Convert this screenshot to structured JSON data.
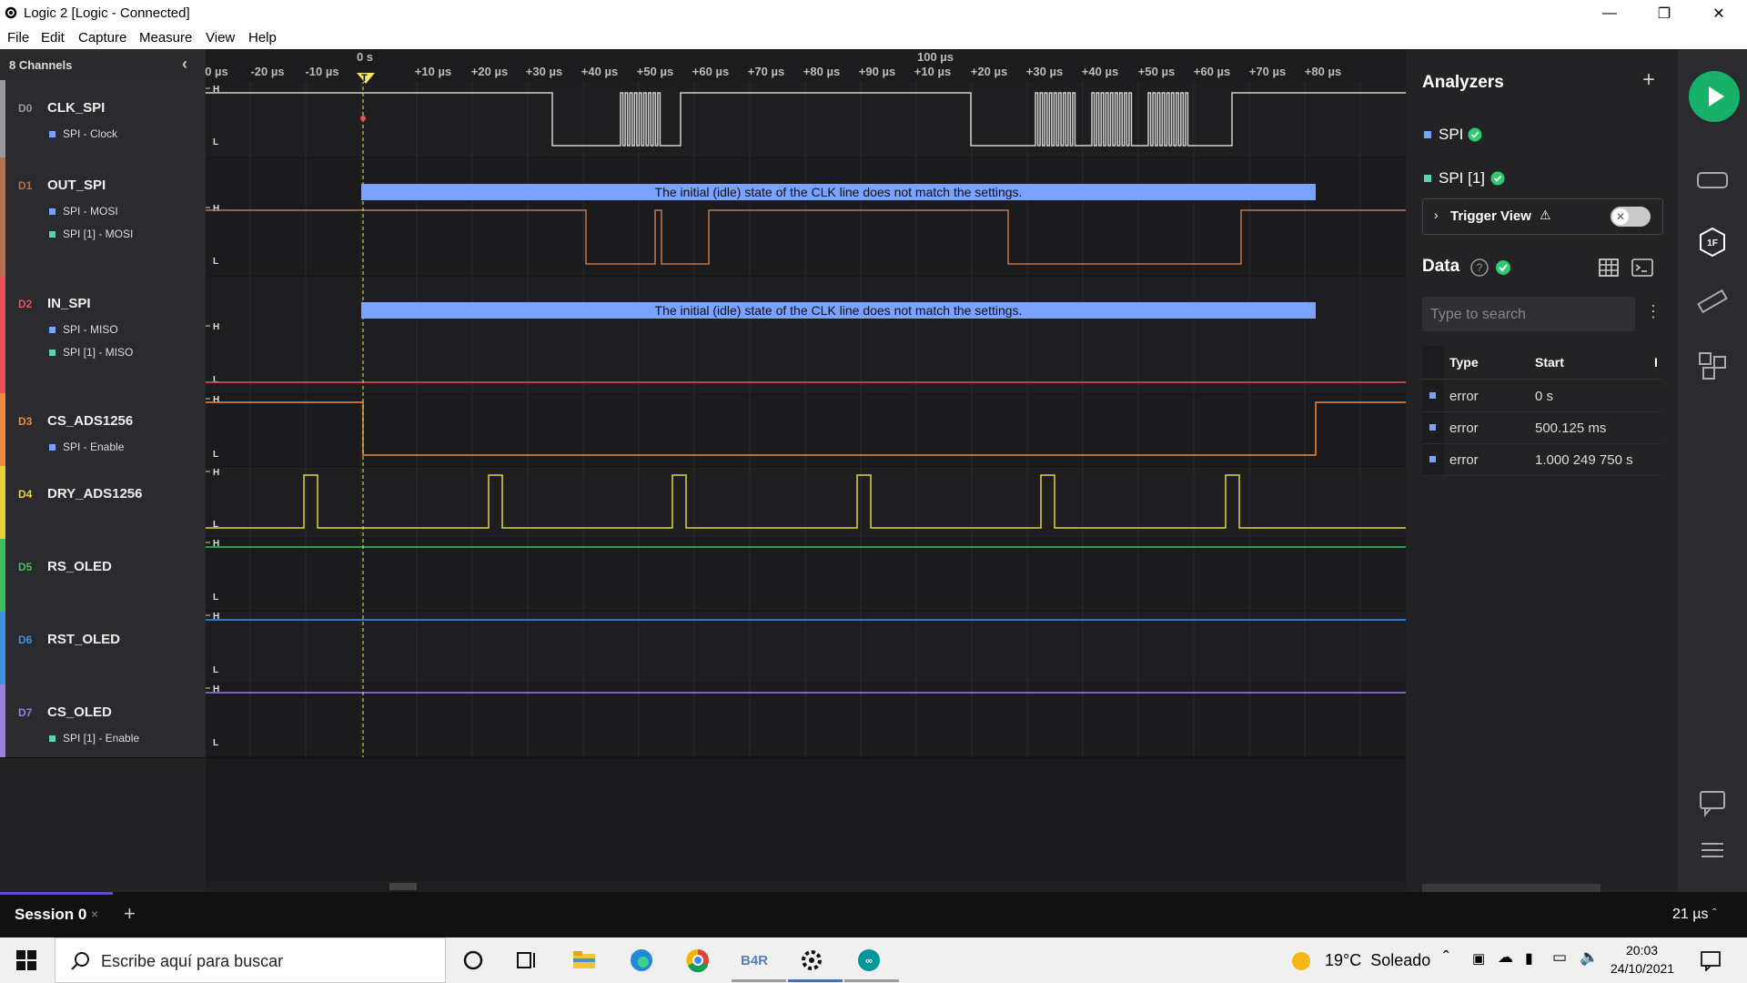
{
  "window": {
    "title": "Logic 2 [Logic - Connected]",
    "controls": [
      "minimize-icon",
      "restore-icon",
      "close-icon"
    ]
  },
  "menu": [
    "File",
    "Edit",
    "Capture",
    "Measure",
    "View",
    "Help"
  ],
  "channels_header": "8 Channels",
  "channels": [
    {
      "id": "D0",
      "name": "CLK_SPI",
      "color": "#9a9a9a",
      "subs": [
        {
          "label": "SPI - Clock",
          "color": "#7aa3ff"
        }
      ]
    },
    {
      "id": "D1",
      "name": "OUT_SPI",
      "color": "#b4714f",
      "subs": [
        {
          "label": "SPI - MOSI",
          "color": "#7aa3ff"
        },
        {
          "label": "SPI [1] - MOSI",
          "color": "#5fd0b0"
        }
      ]
    },
    {
      "id": "D2",
      "name": "IN_SPI",
      "color": "#e8505b",
      "subs": [
        {
          "label": "SPI - MISO",
          "color": "#7aa3ff"
        },
        {
          "label": "SPI [1] - MISO",
          "color": "#5fd0b0"
        }
      ]
    },
    {
      "id": "D3",
      "name": "CS_ADS1256",
      "color": "#f08a3c",
      "subs": [
        {
          "label": "SPI - Enable",
          "color": "#7aa3ff"
        }
      ]
    },
    {
      "id": "D4",
      "name": "DRY_ADS1256",
      "color": "#e6d23a",
      "subs": []
    },
    {
      "id": "D5",
      "name": "RS_OLED",
      "color": "#3fbf5f",
      "subs": []
    },
    {
      "id": "D6",
      "name": "RST_OLED",
      "color": "#3f8fe0",
      "subs": []
    },
    {
      "id": "D7",
      "name": "CS_OLED",
      "color": "#9a7fe0",
      "subs": [
        {
          "label": "SPI [1] - Enable",
          "color": "#5fd0b0"
        }
      ]
    }
  ],
  "level_labels": {
    "high": "H",
    "low": "L"
  },
  "ruler": {
    "zero_label": "0 s",
    "hundred_label": "100 µs",
    "trigger_label": "T",
    "ticks": [
      "0 µs",
      "-20 µs",
      "-10 µs",
      "+10 µs",
      "+20 µs",
      "+30 µs",
      "+40 µs",
      "+50 µs",
      "+60 µs",
      "+70 µs",
      "+80 µs",
      "+90 µs",
      "+10 µs",
      "+20 µs",
      "+30 µs",
      "+40 µs",
      "+50 µs",
      "+60 µs",
      "+70 µs",
      "+80 µs"
    ]
  },
  "error_message": "The initial (idle) state of the CLK line does not match the settings.",
  "analyzers": {
    "title": "Analyzers",
    "add_icon": "plus-icon",
    "items": [
      {
        "label": "SPI",
        "status": "check-icon"
      },
      {
        "label": "SPI [1]",
        "status": "check-icon"
      }
    ],
    "trigger_view": "Trigger View",
    "trigger_warning": "⚠"
  },
  "data_panel": {
    "title": "Data",
    "search_placeholder": "Type to search",
    "columns": [
      "Type",
      "Start",
      "I"
    ],
    "rows": [
      {
        "type": "error",
        "start": "0 s"
      },
      {
        "type": "error",
        "start": "500.125 ms"
      },
      {
        "type": "error",
        "start": "1.000 249 750 s"
      }
    ]
  },
  "session": {
    "tab": "Session 0",
    "zoom": "21 µs"
  },
  "taskbar": {
    "search_placeholder": "Escribe aquí para buscar",
    "weather": "19°C  Soleado",
    "time": "20:03",
    "date": "24/10/2021",
    "b4r_label": "B4R"
  },
  "colors": {
    "accent_green": "#17b169",
    "error_bar": "#7aa3ff",
    "check_green": "#2ecc71"
  }
}
